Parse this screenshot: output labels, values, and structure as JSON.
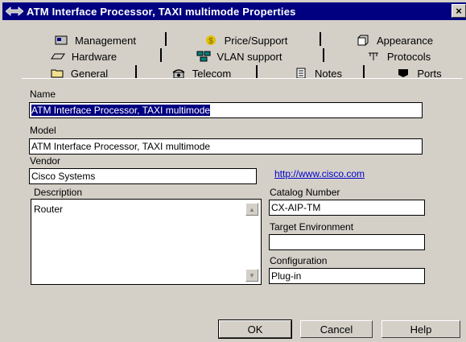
{
  "window": {
    "title": "ATM Interface Processor, TAXI multimode Properties",
    "close_glyph": "×"
  },
  "tabs": {
    "row1": [
      {
        "label": "Management",
        "icon": "management-icon"
      },
      {
        "label": "Price/Support",
        "icon": "dollar-icon"
      },
      {
        "label": "Appearance",
        "icon": "appearance-icon"
      }
    ],
    "row2": [
      {
        "label": "Hardware",
        "icon": "hardware-icon"
      },
      {
        "label": "VLAN support",
        "icon": "vlan-icon"
      },
      {
        "label": "Protocols",
        "icon": "protocols-icon"
      }
    ],
    "row3": [
      {
        "label": "General",
        "icon": "folder-icon",
        "active": true
      },
      {
        "label": "Telecom",
        "icon": "telecom-icon"
      },
      {
        "label": "Notes",
        "icon": "notes-icon"
      },
      {
        "label": "Ports",
        "icon": "ports-icon"
      }
    ]
  },
  "form": {
    "name_label": "Name",
    "name_value": "ATM Interface Processor, TAXI multimode",
    "model_label": "Model",
    "model_value": "ATM Interface Processor, TAXI multimode",
    "vendor_label": "Vendor",
    "vendor_value": "Cisco Systems",
    "vendor_link": "http://www.cisco.com",
    "description_label": "Description",
    "description_value": "Router",
    "catalog_label": "Catalog Number",
    "catalog_value": "CX-AIP-TM",
    "target_label": "Target Environment",
    "target_value": "",
    "config_label": "Configuration",
    "config_value": "Plug-in"
  },
  "buttons": {
    "ok": "OK",
    "cancel": "Cancel",
    "help": "Help"
  }
}
